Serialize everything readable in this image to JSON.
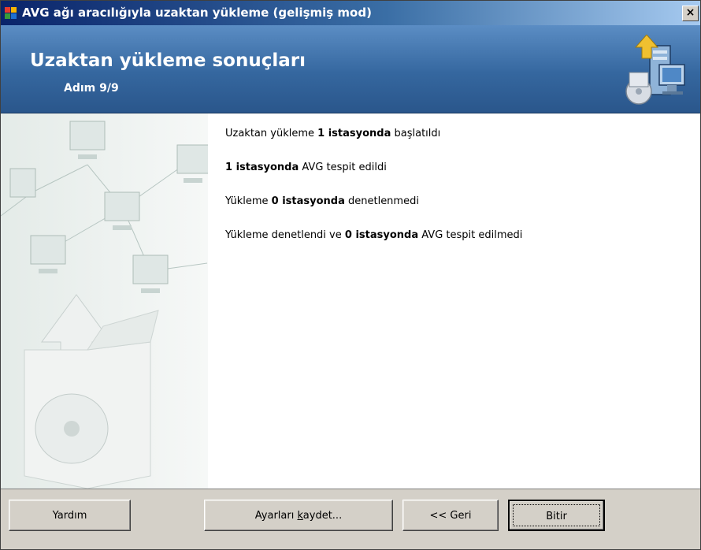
{
  "window": {
    "title": "AVG ağı aracılığıyla uzaktan yükleme (gelişmiş mod)",
    "close_label": "×"
  },
  "header": {
    "title": "Uzaktan yükleme sonuçları",
    "step": "Adım 9/9"
  },
  "results": [
    {
      "pre": "Uzaktan yükleme ",
      "bold": "1 istasyonda",
      "post": " başlatıldı"
    },
    {
      "pre": "",
      "bold": "1 istasyonda",
      "post": " AVG tespit edildi"
    },
    {
      "pre": "Yükleme ",
      "bold": "0 istasyonda",
      "post": " denetlenmedi"
    },
    {
      "pre": "Yükleme denetlendi ve ",
      "bold": "0 istasyonda",
      "post": " AVG tespit edilmedi"
    }
  ],
  "buttons": {
    "help": "Yardım",
    "save_pre": "Ayarları ",
    "save_u": "k",
    "save_post": "aydet...",
    "back": "<< Geri",
    "finish": "Bitir"
  },
  "colors": {
    "header_blue": "#35679f",
    "title_bar": "#0a246a",
    "dialog_face": "#d4d0c8"
  }
}
